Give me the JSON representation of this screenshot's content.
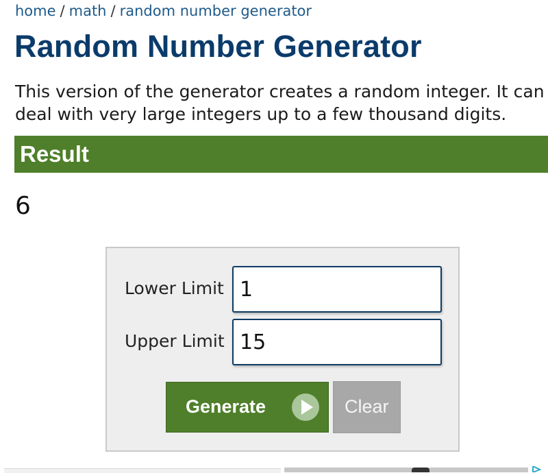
{
  "breadcrumb": {
    "items": [
      "home",
      "math",
      "random number generator"
    ],
    "separator": "/"
  },
  "page": {
    "title": "Random Number Generator",
    "description_line1": "This version of the generator creates a random integer. It can",
    "description_line2": "deal with very large integers up to a few thousand digits."
  },
  "result": {
    "heading": "Result",
    "value": "6"
  },
  "form": {
    "lower_label": "Lower Limit",
    "lower_value": "1",
    "upper_label": "Upper Limit",
    "upper_value": "15",
    "generate_label": "Generate",
    "clear_label": "Clear"
  },
  "colors": {
    "accent_green": "#4f7f2a",
    "title_blue": "#0b3b6b",
    "link_blue": "#1f5a8a",
    "clear_gray": "#a8a8a8"
  },
  "icons": {
    "generate": "play-circle-icon",
    "ad": "ad-choices-icon"
  }
}
